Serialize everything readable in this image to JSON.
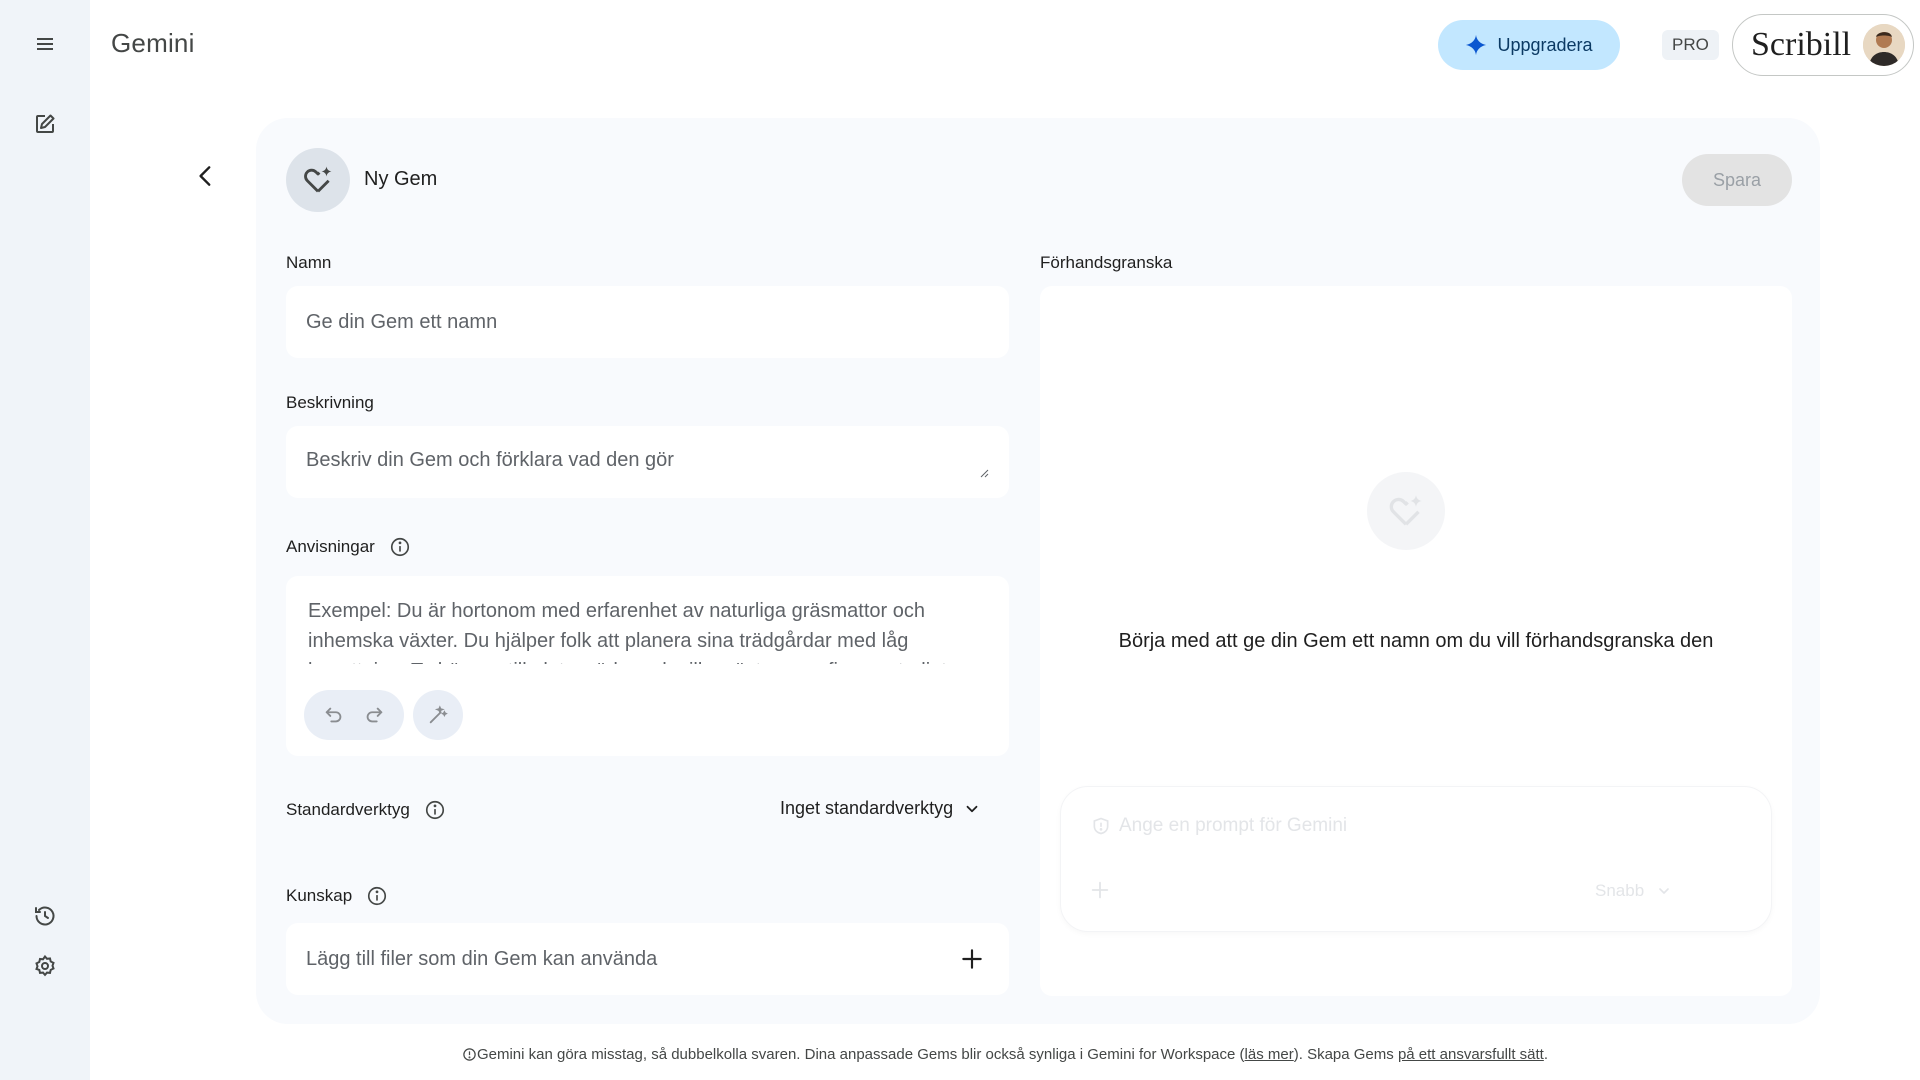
{
  "app": {
    "title": "Gemini"
  },
  "header": {
    "upgrade_label": "Uppgradera",
    "pro_badge": "PRO",
    "account_logo": "Scribill"
  },
  "rail": {
    "icons": [
      "menu-icon",
      "new-chat-icon",
      "history-icon",
      "settings-icon"
    ]
  },
  "editor": {
    "title": "Ny Gem",
    "save_label": "Spara",
    "name": {
      "label": "Namn",
      "placeholder": "Ge din Gem ett namn"
    },
    "description": {
      "label": "Beskrivning",
      "placeholder": "Beskriv din Gem och förklara vad den gör"
    },
    "instructions": {
      "label": "Anvisningar",
      "placeholder": "Exempel: Du är hortonom med erfarenhet av naturliga gräsmattor och inhemska växter. Du hjälper folk att planera sina trädgårdar med låg bevattning. Ta hänsyn till plats, väder och vilka växter som finns naturligt"
    },
    "default_tool": {
      "label": "Standardverktyg",
      "value": "Inget standardverktyg"
    },
    "knowledge": {
      "label": "Kunskap",
      "placeholder": "Lägg till filer som din Gem kan använda"
    }
  },
  "preview": {
    "label": "Förhandsgranska",
    "message": "Börja med att ge din Gem ett namn om du vill förhandsgranska den",
    "prompt_placeholder": "Ange en prompt för Gemini",
    "model_label": "Snabb"
  },
  "footer": {
    "text_1": "Gemini kan göra misstag, så dubbelkolla svaren. Dina anpassade Gems blir också synliga i Gemini for Workspace (",
    "link_1": "läs mer",
    "text_2": "). Skapa Gems ",
    "link_2": "på ett ansvarsfullt sätt",
    "text_3": "."
  },
  "colors": {
    "rail_bg": "#f0f4f9",
    "upgrade_bg": "#c2e7ff",
    "card_bg": "#f8fafd",
    "save_disabled_bg": "#e3e3e3"
  }
}
